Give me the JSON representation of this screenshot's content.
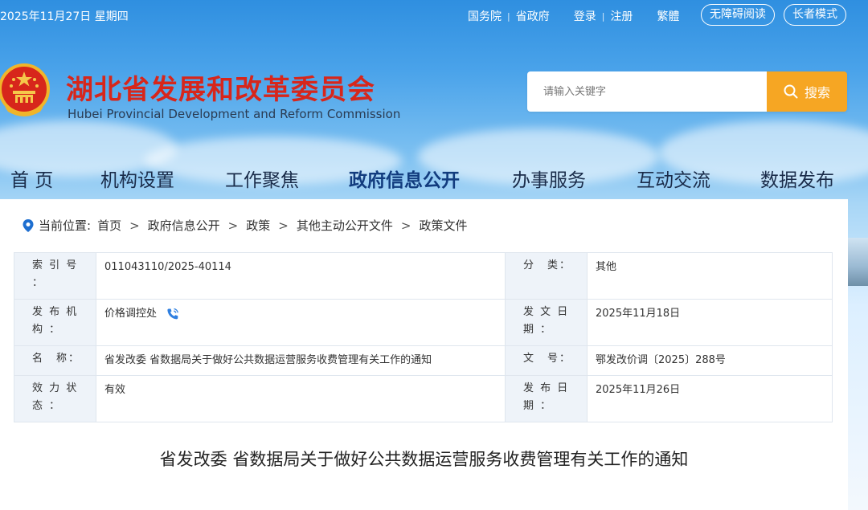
{
  "topbar": {
    "date": "2025年11月27日 星期四",
    "links": [
      "国务院",
      "省政府"
    ],
    "auth": [
      "登录",
      "注册"
    ],
    "traditional": "繁體",
    "accessibility": "无障碍阅读",
    "elder_mode": "长者模式"
  },
  "header": {
    "title": "湖北省发展和改革委员会",
    "subtitle": "Hubei Provincial Development and Reform Commission"
  },
  "search": {
    "placeholder": "请输入关键字",
    "button": "搜索"
  },
  "nav": {
    "items": [
      "首 页",
      "机构设置",
      "工作聚焦",
      "政府信息公开",
      "办事服务",
      "互动交流",
      "数据发布"
    ]
  },
  "breadcrumb": {
    "label": "当前位置:",
    "items": [
      "首页",
      "政府信息公开",
      "政策",
      "其他主动公开文件",
      "政策文件"
    ]
  },
  "meta": {
    "index_label": "索 引 号 ：",
    "index_value": "011043110/2025-40114",
    "category_label": "分　类：",
    "category_value": "其他",
    "publisher_label": "发 布 机 构 ：",
    "publisher_value": "价格调控处",
    "issue_date_label": "发 文 日 期 ：",
    "issue_date_value": "2025年11月18日",
    "name_label": "名　称：",
    "name_value": "省发改委 省数据局关于做好公共数据运营服务收费管理有关工作的通知",
    "doc_no_label": "文　号：",
    "doc_no_value": "鄂发改价调〔2025〕288号",
    "status_label": "效 力 状 态 ：",
    "status_value": "有效",
    "publish_date_label": "发 布 日 期 ：",
    "publish_date_value": "2025年11月26日"
  },
  "document": {
    "title": "省发改委 省数据局关于做好公共数据运营服务收费管理有关工作的通知"
  },
  "colors": {
    "brand_red": "#d7261b",
    "accent_orange": "#f6a623",
    "sky_blue": "#4aa3ea"
  }
}
